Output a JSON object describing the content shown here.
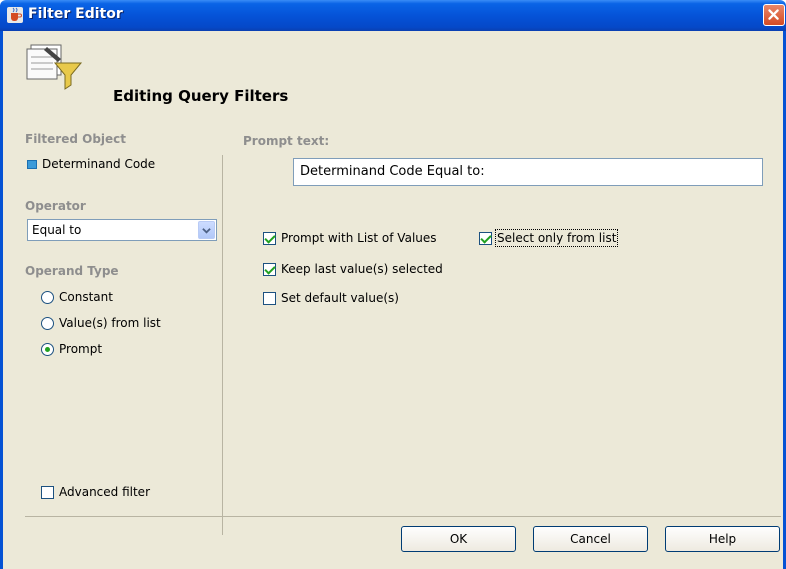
{
  "window": {
    "title": "Filter Editor",
    "header": "Editing Query Filters"
  },
  "left_panel": {
    "filtered_object_label": "Filtered Object",
    "filtered_object_value": "Determinand Code",
    "operator_label": "Operator",
    "operator_value": "Equal to",
    "operand_type_label": "Operand Type",
    "operand_options": [
      {
        "label": "Constant",
        "checked": false
      },
      {
        "label": "Value(s) from list",
        "checked": false
      },
      {
        "label": "Prompt",
        "checked": true
      }
    ],
    "advanced_filter_label": "Advanced filter",
    "advanced_filter_checked": false
  },
  "right_panel": {
    "prompt_text_label": "Prompt text:",
    "prompt_text_value": "Determinand Code Equal to:",
    "options": {
      "prompt_with_lov": {
        "label": "Prompt with List of Values",
        "checked": true
      },
      "select_only_from_list": {
        "label": "Select only from list",
        "checked": true
      },
      "keep_last_values": {
        "label": "Keep last value(s) selected",
        "checked": true
      },
      "set_default_values": {
        "label": "Set default value(s)",
        "checked": false
      }
    }
  },
  "buttons": {
    "ok": "OK",
    "cancel": "Cancel",
    "help": "Help"
  },
  "colors": {
    "titlebar": "#0553d8",
    "window_bg": "#ece9d8",
    "section_label": "#8e8e8e",
    "check_green": "#21a121",
    "close_red": "#d44a23"
  },
  "icons": {
    "app": "java-cup-icon",
    "header": "filter-funnel-icon",
    "object": "dimension-object-icon",
    "close": "close-icon",
    "dropdown": "chevron-down-icon"
  }
}
